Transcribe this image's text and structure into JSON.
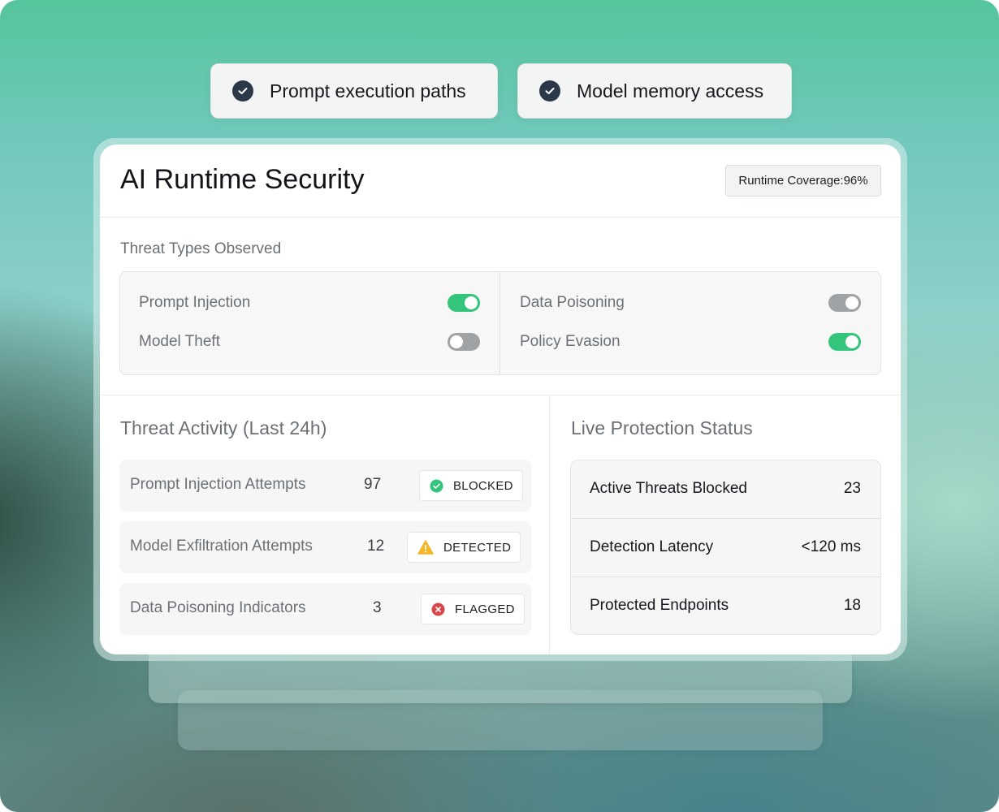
{
  "chips": [
    {
      "label": "Prompt execution paths",
      "icon": "check-circle-icon"
    },
    {
      "label": "Model memory access",
      "icon": "check-circle-icon"
    }
  ],
  "card": {
    "title": "AI Runtime Security",
    "coverage": "Runtime Coverage:96%"
  },
  "threat_types": {
    "label": "Threat Types Observed",
    "items": [
      {
        "label": "Prompt Injection",
        "enabled": true
      },
      {
        "label": "Data Poisoning",
        "enabled": false
      },
      {
        "label": "Model Theft",
        "enabled": false
      },
      {
        "label": "Policy Evasion",
        "enabled": true
      }
    ]
  },
  "activity": {
    "title": "Threat Activity (Last 24h)",
    "rows": [
      {
        "name": "Prompt Injection Attempts",
        "count": "97",
        "status": "BLOCKED",
        "status_icon": "check-circle-icon",
        "status_color": "#34c47c"
      },
      {
        "name": "Model Exfiltration Attempts",
        "count": "12",
        "status": "DETECTED",
        "status_icon": "warning-triangle-icon",
        "status_color": "#f5b62a"
      },
      {
        "name": "Data Poisoning Indicators",
        "count": "3",
        "status": "FLAGGED",
        "status_icon": "x-circle-icon",
        "status_color": "#d9474d"
      }
    ]
  },
  "live": {
    "title": "Live Protection Status",
    "rows": [
      {
        "name": "Active Threats Blocked",
        "value": "23"
      },
      {
        "name": "Detection Latency",
        "value": "<120 ms"
      },
      {
        "name": "Protected Endpoints",
        "value": "18"
      }
    ]
  },
  "colors": {
    "toggle_on": "#34c47c",
    "toggle_off": "#9fa3a5",
    "check_bg": "#2b3848"
  }
}
